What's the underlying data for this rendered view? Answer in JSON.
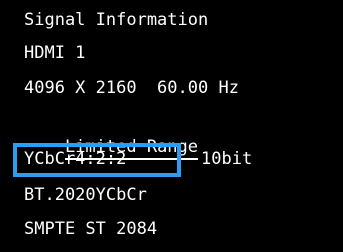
{
  "signal_info": {
    "title": "Signal Information",
    "input": "HDMI 1",
    "resolution_refresh": "4096 X 2160  60.00 Hz",
    "range": "Limited Range",
    "color_format": "YCbCr4:2:2",
    "bit_depth": "10bit",
    "colorimetry": "BT.2020YCbCr",
    "eotf": "SMPTE ST 2084"
  },
  "colors": {
    "background": "#000000",
    "text": "#ffffff",
    "highlight": "#2a9df4"
  }
}
